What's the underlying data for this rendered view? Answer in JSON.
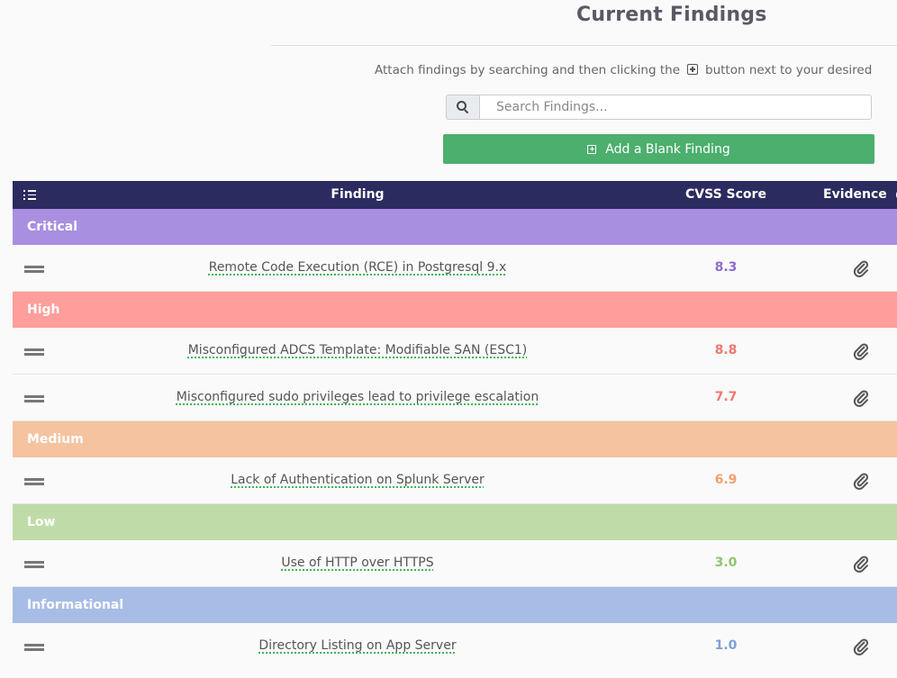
{
  "header": {
    "title": "Current Findings",
    "help_text_before": "Attach findings by searching and then clicking the",
    "help_text_after": "button next to your desired"
  },
  "search": {
    "placeholder": "Search Findings...",
    "value": ""
  },
  "actions": {
    "add_blank_label": "Add a Blank Finding"
  },
  "table": {
    "columns": {
      "finding": "Finding",
      "cvss": "CVSS Score",
      "evidence": "Evidence"
    },
    "groups": [
      {
        "severity": "Critical",
        "color": "#a98fe0",
        "score_color": "#8e6bd0",
        "findings": [
          {
            "title": "Remote Code Execution (RCE) in Postgresql 9.x",
            "score": "8.3"
          }
        ]
      },
      {
        "severity": "High",
        "color": "#ff9e9a",
        "score_color": "#f0776f",
        "findings": [
          {
            "title": "Misconfigured ADCS Template: Modifiable SAN (ESC1)",
            "score": "8.8"
          },
          {
            "title": "Misconfigured sudo privileges lead to privilege escalation",
            "score": "7.7"
          }
        ]
      },
      {
        "severity": "Medium",
        "color": "#f5c39f",
        "score_color": "#f0a070",
        "findings": [
          {
            "title": "Lack of Authentication on Splunk Server",
            "score": "6.9"
          }
        ]
      },
      {
        "severity": "Low",
        "color": "#bfdca8",
        "score_color": "#8fc46f",
        "findings": [
          {
            "title": "Use of HTTP over HTTPS",
            "score": "3.0"
          }
        ]
      },
      {
        "severity": "Informational",
        "color": "#a8bde6",
        "score_color": "#7d9fd8",
        "findings": [
          {
            "title": "Directory Listing on App Server",
            "score": "1.0"
          }
        ]
      }
    ]
  },
  "colors": {
    "header_bg": "#2b2b5f",
    "button_green": "#4caf6e"
  },
  "icons": {
    "drag": "drag-handle-icon",
    "evidence": "paperclip-icon",
    "search": "search-icon",
    "list": "list-ordered-icon"
  }
}
